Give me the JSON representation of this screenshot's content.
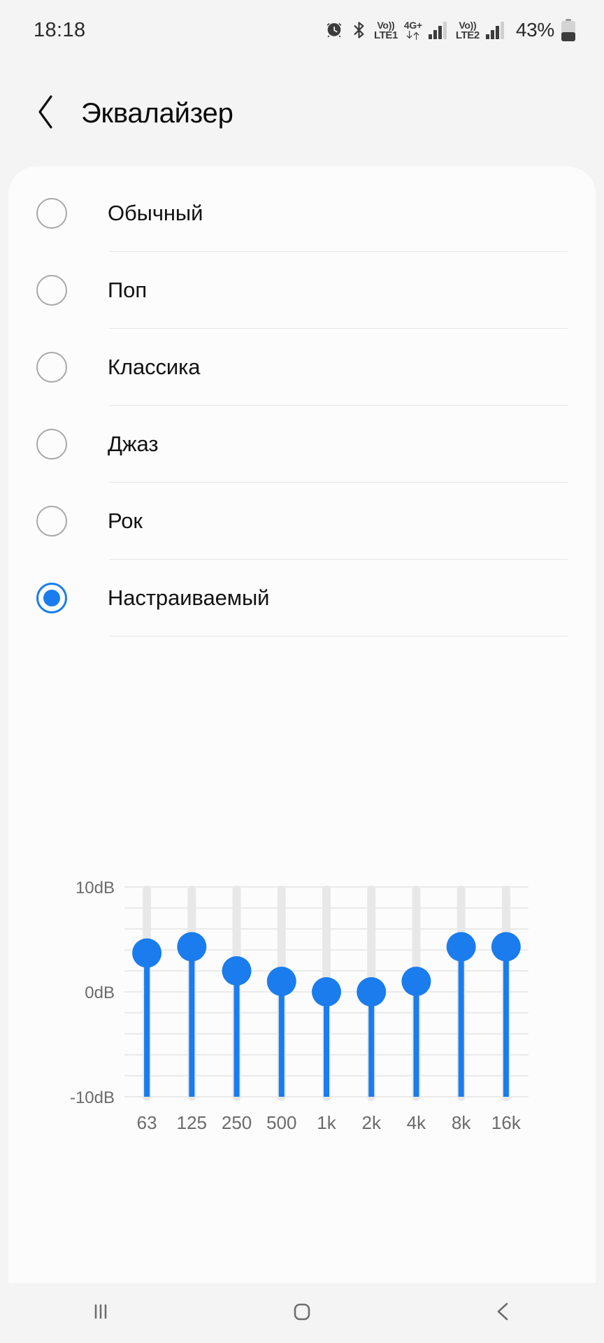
{
  "status_bar": {
    "time": "18:18",
    "battery_percent": "43%",
    "icons": [
      "alarm-icon",
      "bluetooth-icon",
      "volte1-icon",
      "network-4g-plus-icon",
      "signal-bars-1-icon",
      "volte2-icon",
      "signal-bars-2-icon",
      "battery-icon"
    ],
    "volte_1_top": "Vo))",
    "volte_1_bottom": "LTE1",
    "network_type": "4G+",
    "volte_2_top": "Vo))",
    "volte_2_bottom": "LTE2"
  },
  "header": {
    "back_icon": "chevron-left-icon",
    "title": "Эквалайзер"
  },
  "presets": {
    "items": [
      {
        "label": "Обычный",
        "selected": false
      },
      {
        "label": "Поп",
        "selected": false
      },
      {
        "label": "Классика",
        "selected": false
      },
      {
        "label": "Джаз",
        "selected": false
      },
      {
        "label": "Рок",
        "selected": false
      },
      {
        "label": "Настраиваемый",
        "selected": true
      }
    ]
  },
  "colors": {
    "accent": "#1a7ced",
    "track": "#e8e8e8",
    "grid": "#eaeaea",
    "card_bg": "#fcfcfc",
    "page_bg": "#f4f4f4",
    "text": "#121212",
    "axis_text": "#6b6b6b"
  },
  "chart_data": {
    "type": "bar",
    "title": "",
    "xlabel": "",
    "ylabel": "",
    "categories": [
      "63",
      "125",
      "250",
      "500",
      "1k",
      "2k",
      "4k",
      "8k",
      "16k"
    ],
    "values": [
      3.7,
      4.3,
      2.0,
      1.0,
      0.0,
      0.0,
      1.0,
      4.3,
      4.3
    ],
    "ylim": [
      -10,
      10
    ],
    "y_tick_labels": [
      "10dB",
      "0dB",
      "-10dB"
    ],
    "y_tick_values": [
      10,
      0,
      -10
    ],
    "grid_step_db": 2,
    "grid": true,
    "legend": "none",
    "unit": "dB"
  },
  "nav_bar": {
    "recents_icon": "recents-icon",
    "home_icon": "home-icon",
    "back_icon": "back-icon"
  }
}
